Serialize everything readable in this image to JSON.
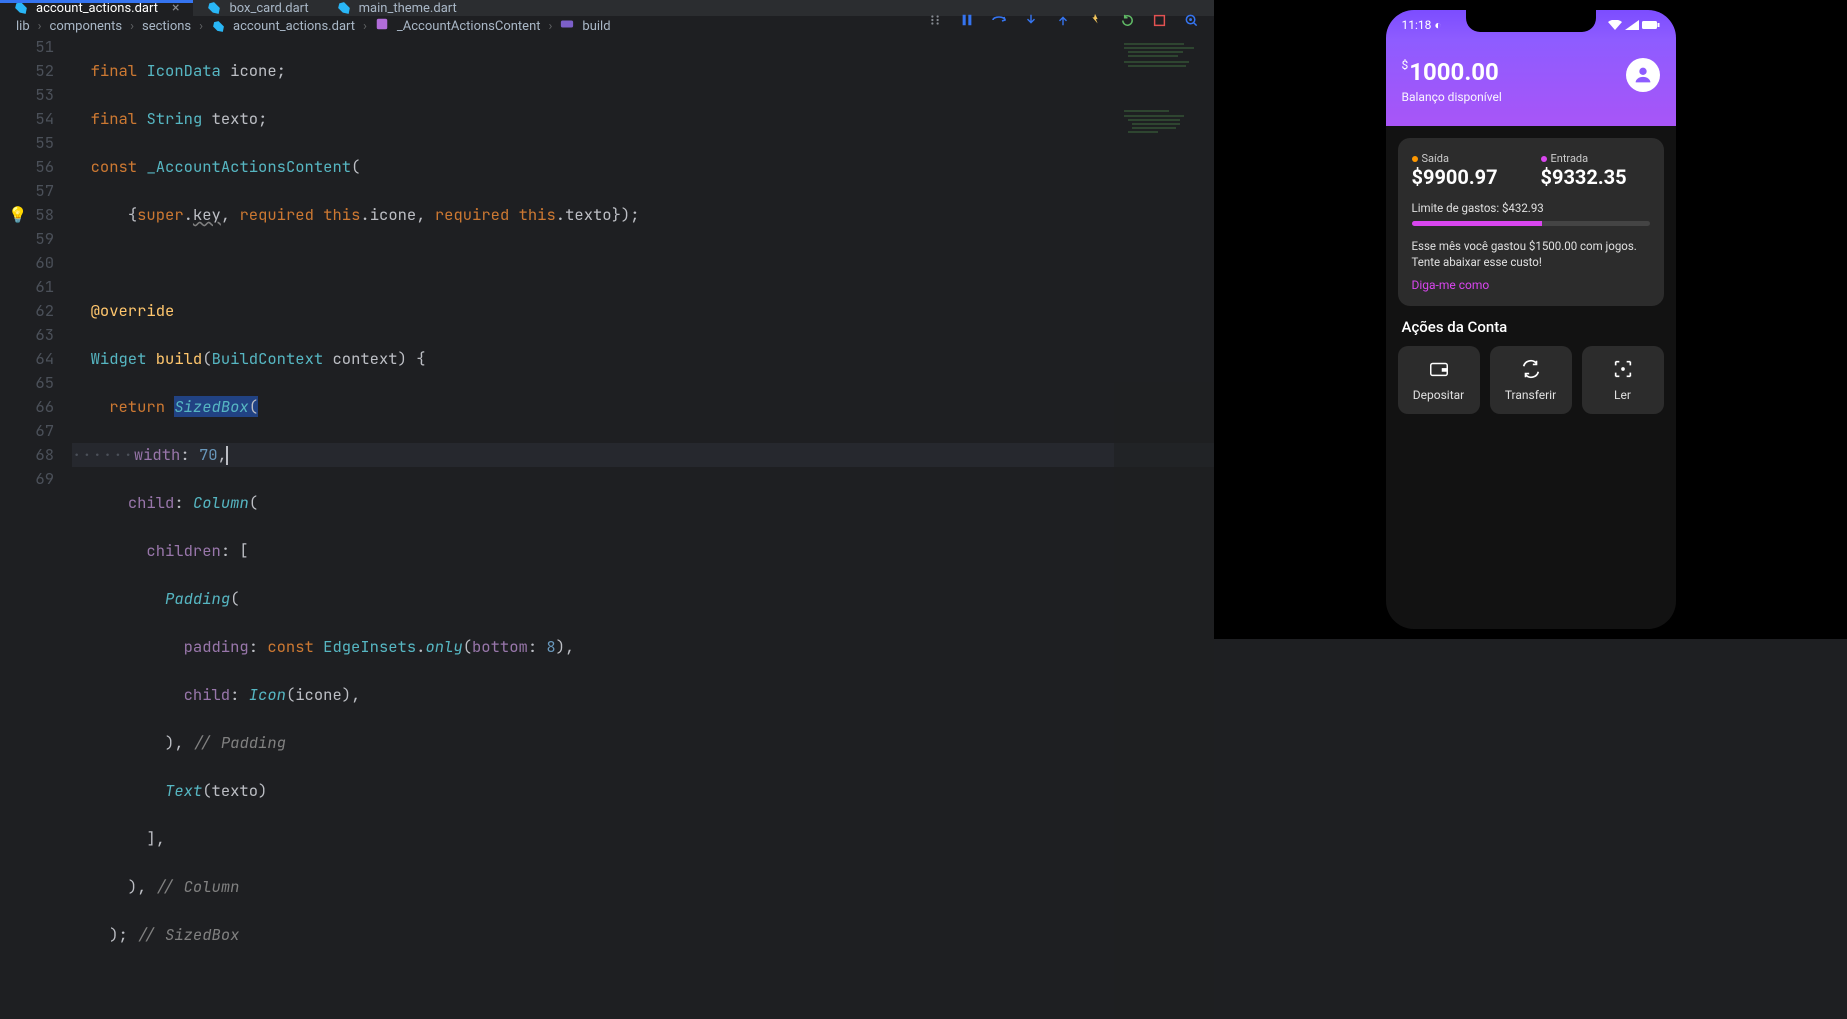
{
  "tabs": [
    {
      "label": "account_actions.dart",
      "active": true
    },
    {
      "label": "box_card.dart",
      "active": false
    },
    {
      "label": "main_theme.dart",
      "active": false
    }
  ],
  "breadcrumbs": {
    "c0": "lib",
    "c1": "components",
    "c2": "sections",
    "c3": "account_actions.dart",
    "c4": "_AccountActionsContent",
    "c5": "build"
  },
  "lines": {
    "start": 51,
    "end": 69
  },
  "code": {
    "l51": {
      "kw": "final",
      "type": "IconData",
      "ident": "icone",
      "semi": ";"
    },
    "l52": {
      "kw": "final",
      "type": "String",
      "ident": "texto",
      "semi": ";"
    },
    "l53": {
      "kw": "const",
      "ctor": "_AccountActionsContent",
      "open": "("
    },
    "l54": {
      "open": "{",
      "super": "super",
      "dot": ".",
      "key": "key",
      "comma1": ",",
      "req1": "required",
      "this1": "this",
      "dot1": ".",
      "icone": "icone",
      "comma2": ",",
      "req2": "required",
      "this2": "this",
      "dot2": ".",
      "texto": "texto",
      "close": "});"
    },
    "l56": {
      "annot": "@override"
    },
    "l57": {
      "type": "Widget",
      "method": "build",
      "open": "(",
      "ptype": "BuildContext",
      "pname": "context",
      "close": ")",
      "brace": " {"
    },
    "l58": {
      "kw": "return",
      "call": "SizedBox",
      "open": "("
    },
    "l59": {
      "prop": "width",
      "colon": ": ",
      "val": "70",
      "comma": ","
    },
    "l60": {
      "prop": "child",
      "colon": ": ",
      "call": "Column",
      "open": "("
    },
    "l61": {
      "prop": "children",
      "colon": ": ",
      "open": "["
    },
    "l62": {
      "call": "Padding",
      "open": "("
    },
    "l63": {
      "prop": "padding",
      "colon": ": ",
      "kw": "const",
      "call": "EdgeInsets",
      "dot": ".",
      "method": "only",
      "open": "(",
      "arg": "bottom",
      "acolon": ": ",
      "val": "8",
      "close": "),"
    },
    "l64": {
      "prop": "child",
      "colon": ": ",
      "call": "Icon",
      "open": "(",
      "arg": "icone",
      "close": "),"
    },
    "l65": {
      "close": "),",
      "comment": "// Padding"
    },
    "l66": {
      "call": "Text",
      "open": "(",
      "arg": "texto",
      "close": ")"
    },
    "l67": {
      "close": "],"
    },
    "l68": {
      "close": "),",
      "comment": "// Column"
    },
    "l69": {
      "close": ");",
      "comment": "// SizedBox"
    }
  },
  "phone": {
    "time": "11:18",
    "balance_currency": "$",
    "balance": "1000.00",
    "balance_label": "Balanço disponível",
    "out_label": "Saída",
    "out_val": "$9900.97",
    "in_label": "Entrada",
    "in_val": "$9332.35",
    "limit_text": "Limite de gastos: $432.93",
    "msg": "Esse mês você gastou $1500.00 com jogos. Tente abaixar esse custo!",
    "link": "Diga-me como",
    "section_title": "Ações da Conta",
    "actions": {
      "a0": "Depositar",
      "a1": "Transferir",
      "a2": "Ler"
    }
  }
}
